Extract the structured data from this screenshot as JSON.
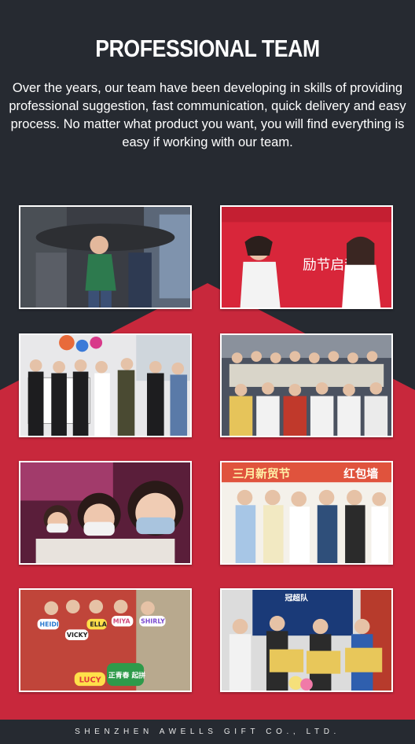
{
  "header": {
    "title": "PROFESSIONAL TEAM",
    "description": "Over the years, our team have been developing in skills of providing professional suggestion, fast communication, quick delivery and easy process. No matter what product you want, you will find everything is easy if working with our team."
  },
  "colors": {
    "background": "#262a31",
    "accent_red": "#c8283c",
    "text": "#ffffff"
  },
  "photos": [
    {
      "id": "team-photo-hands",
      "desc": "team members joining hands"
    },
    {
      "id": "team-photo-whiteboard",
      "desc": "two women writing on red board"
    },
    {
      "id": "team-photo-drawings",
      "desc": "group with drawing boards"
    },
    {
      "id": "team-photo-group-masks",
      "desc": "large group photo with masks"
    },
    {
      "id": "team-photo-selfie",
      "desc": "selfie with masks"
    },
    {
      "id": "team-photo-event-wall",
      "desc": "group in front of event wall"
    },
    {
      "id": "team-photo-props",
      "desc": "group holding name props"
    },
    {
      "id": "team-photo-awards",
      "desc": "award ceremony with certificates"
    }
  ],
  "photo_text": {
    "event_banner_left": "三月新贸节",
    "event_banner_right": "红包墙",
    "board_text": "励节启动",
    "prop_names": [
      "HEIDI",
      "VICKY",
      "ELLA",
      "MIYA",
      "SHIRLY",
      "LUCY"
    ],
    "prop_slogan": "正青春 起拼",
    "award_banner": "冠超队"
  },
  "footer": {
    "company": "SHENZHEN AWELLS GIFT CO., LTD."
  }
}
